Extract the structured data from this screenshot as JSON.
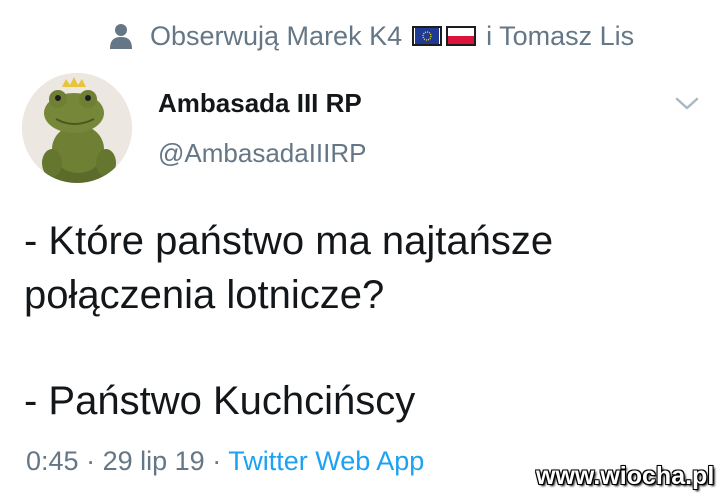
{
  "social_context": {
    "icon": "person-icon",
    "prefix": "Obserwują Marek K4",
    "suffix": "i Tomasz Lis",
    "flags": [
      "eu-flag-icon",
      "poland-flag-icon"
    ]
  },
  "author": {
    "avatar": "frog-prince-plush-avatar",
    "display_name": "Ambasada III RP",
    "handle": "@AmbasadaIIIRP"
  },
  "menu": {
    "icon": "chevron-down-icon"
  },
  "tweet": {
    "line1": "- Które państwo ma najtańsze",
    "line2": "połączenia lotnicze?",
    "line3": "- Państwo Kuchcińscy"
  },
  "meta": {
    "time": "0:45",
    "separator": "·",
    "date": "29 lip 19",
    "source": "Twitter Web App"
  },
  "watermark": "www.wiocha.pl",
  "colors": {
    "text": "#14171a",
    "secondary": "#657786",
    "link": "#1da1f2",
    "background": "#ffffff"
  }
}
